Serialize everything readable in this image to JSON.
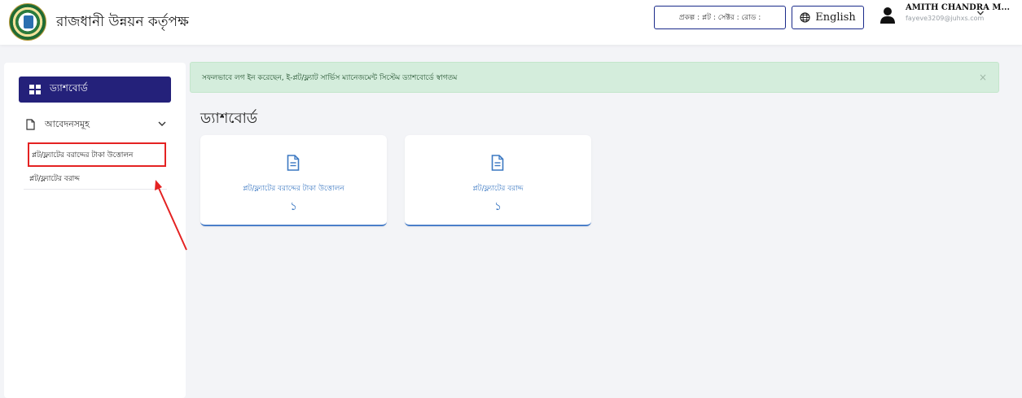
{
  "header": {
    "brand": "রাজধানী উন্নয়ন কর্তৃপক্ষ",
    "project_info": "প্রকল্প :  প্লট :  সেক্টর :  রোড :",
    "language_button": "English",
    "user_name": "AMITH CHANDRA M...",
    "user_email": "fayeve3209@juhxs.com"
  },
  "sidebar": {
    "dashboard": "ড্যাশবোর্ড",
    "applications": "আবেদনসমূহ",
    "sub_items": [
      "প্লট/ফ্ল্যাটের বরাদ্দের টাকা উত্তোলন",
      "প্লট/ফ্ল্যাটের বরাদ্দ"
    ]
  },
  "alert": {
    "message": "সফলভাবে লগ ইন করেছেন, ই-প্লট/ফ্ল্যাট সার্ভিস ম্যানেজমেন্ট সিস্টেম ড্যাশবোর্ডে স্বাগতম",
    "close": "×"
  },
  "main": {
    "title": "ড্যাশবোর্ড",
    "cards": [
      {
        "label": "প্লট/ফ্ল্যাটের বরাদ্দের টাকা উত্তোলন",
        "count": "১"
      },
      {
        "label": "প্লট/ফ্ল্যাটের বরাদ্দ",
        "count": "১"
      }
    ]
  },
  "colors": {
    "primary": "#24217a",
    "accent_blue": "#3b78c2",
    "alert_bg": "#d4eddc",
    "highlight_red": "#e42222"
  },
  "icons": {
    "dashboard": "grid-icon",
    "applications": "file-icon",
    "card": "document-icon",
    "language": "globe-icon",
    "user": "user-icon"
  }
}
